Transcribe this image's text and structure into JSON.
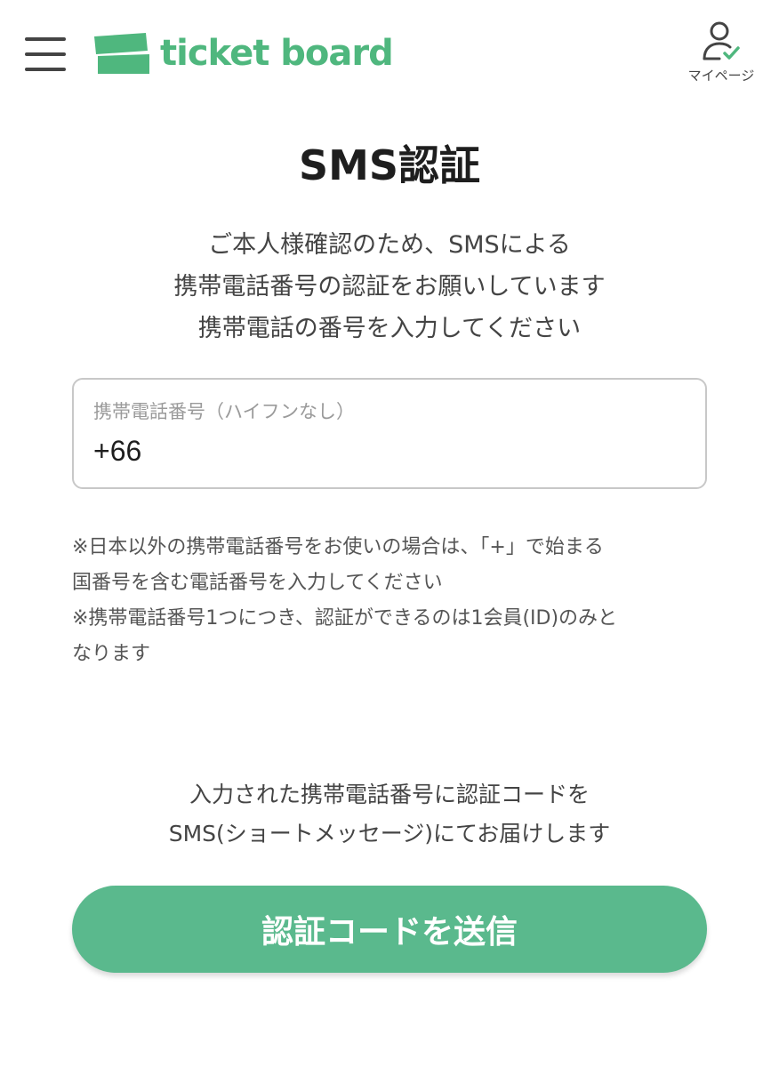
{
  "header": {
    "logo_text": "ticket board",
    "mypage_label": "マイページ",
    "brand_color": "#4fb77e",
    "icons": [
      "hamburger-menu-icon",
      "logo-ticket-icon",
      "user-check-icon"
    ]
  },
  "main": {
    "title": "SMS認証",
    "intro_lines": [
      "ご本人様確認のため、SMSによる",
      "携帯電話番号の認証をお願いしています",
      "携帯電話の番号を入力してください"
    ],
    "phone_field": {
      "label": "携帯電話番号（ハイフンなし）",
      "value": "+66"
    },
    "notes": [
      "※日本以外の携帯電話番号をお使いの場合は、「+」で始まる",
      "国番号を含む電話番号を入力してください",
      "※携帯電話番号1つにつき、認証ができるのは1会員(ID)のみと",
      "なります"
    ],
    "send_info_lines": [
      "入力された携帯電話番号に認証コードを",
      "SMS(ショートメッセージ)にてお届けします"
    ],
    "send_button_label": "認証コードを送信",
    "button_color": "#5ab98d"
  }
}
